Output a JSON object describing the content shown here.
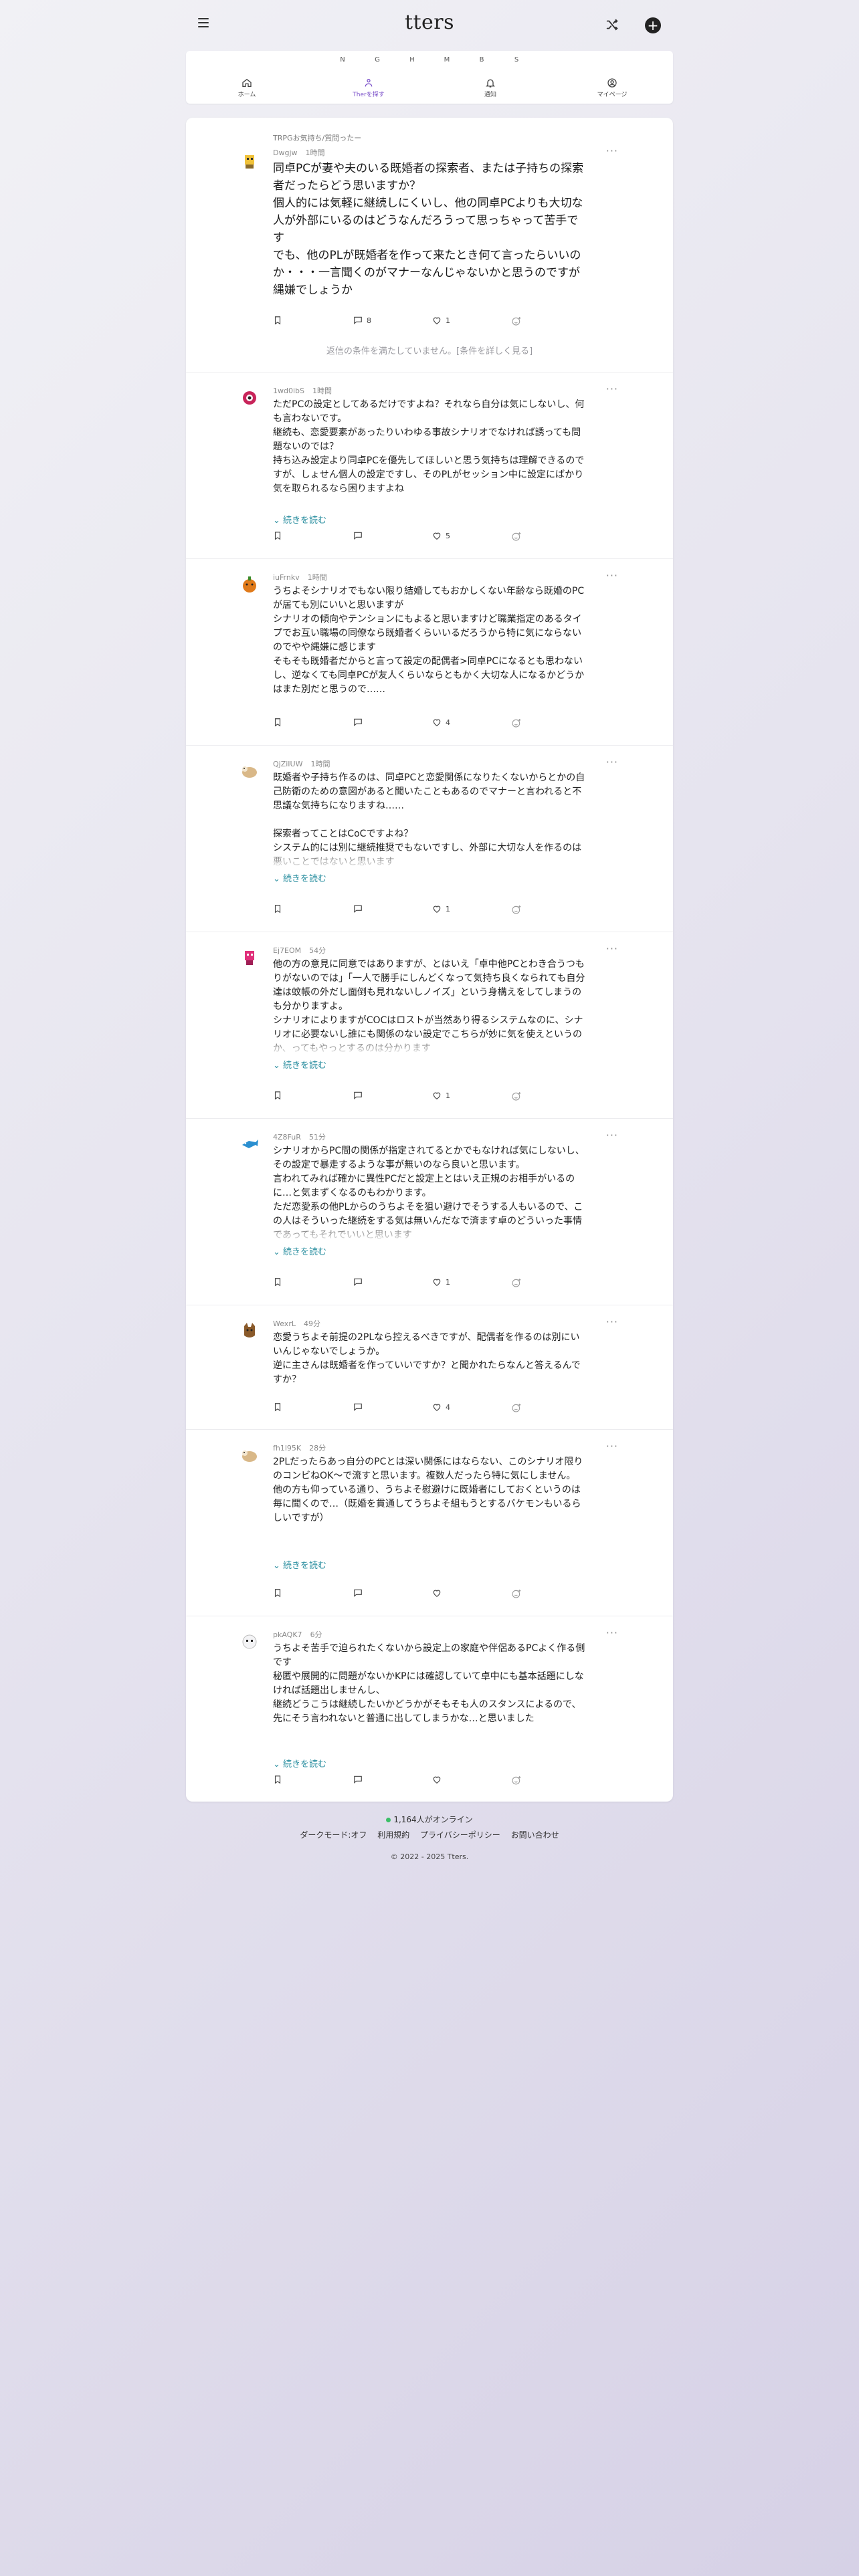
{
  "app": {
    "logo": "tters"
  },
  "letters": [
    "N",
    "G",
    "H",
    "M",
    "B",
    "S"
  ],
  "nav": [
    {
      "label": "ホーム",
      "icon": "home-icon"
    },
    {
      "label": "Therを探す",
      "icon": "people-icon",
      "active": true
    },
    {
      "label": "通知",
      "icon": "bell-icon"
    },
    {
      "label": "マイページ",
      "icon": "user-icon"
    }
  ],
  "feed": {
    "tag": "TRPGお気持ち/質問ったー",
    "hidden_note": "返信の条件を満たしていません。[条件を詳しく見る]",
    "read_more": "続きを読む",
    "posts": [
      {
        "user": "Dwgjw",
        "time": "1時間",
        "text": "同卓PCが妻や夫のいる既婚者の探索者、または子持ちの探索者だったらどう思いますか？\n個人的には気軽に継続しにくいし、他の同卓PCよりも大切な人が外部にいるのはどうなんだろうって思っちゃって苦手です\nでも、他のPLが既婚者を作って来たとき何て言ったらいいのか・・・一言聞くのがマナーなんじゃないかと思うのですが縄嫌でしょうか",
        "replies": "8",
        "likes": "1"
      },
      {
        "user": "1wd0ibS",
        "time": "1時間",
        "text": "ただPCの設定としてあるだけですよね？それなら自分は気にしないし、何も言わないです。\n継続も、恋愛要素があったりいわゆる事故シナリオでなければ誘っても問題ないのでは？\n持ち込み設定より同卓PCを優先してほしいと思う気持ちは理解できるのですが、しょせん個人の設定ですし、そのPLがセッション中に設定にばかり気を取られるなら困りますよね",
        "replies": "",
        "likes": "5"
      },
      {
        "user": "iuFrnkv",
        "time": "1時間",
        "text": "うちよそシナリオでもない限り結婚してもおかしくない年齢なら既婚のPCが居ても別にいいと思いますが\nシナリオの傾向やテンションにもよると思いますけど職業指定のあるタイプでお互い職場の同僚なら既婚者くらいいるだろうから特に気にならないのでやや縄嫌に感じます\nそもそも既婚者だからと言って設定の配偶者>同卓PCになるとも思わないし、逆なくても同卓PCが友人くらいならともかく大切な人になるかどうかはまた別だと思うので……",
        "replies": "",
        "likes": "4"
      },
      {
        "user": "QjZiIUW",
        "time": "1時間",
        "text": "既婚者や子持ち作るのは、同卓PCと恋愛関係になりたくないからとかの自己防衛のための意図があると聞いたこともあるのでマナーと言われると不思議な気持ちになりますね……\n\n探索者ってことはCoCですよね？\nシステム的には別に継続推奨でもないですし、外部に大切な人を作るのは悪いことではないと思います",
        "replies": "",
        "likes": "1"
      },
      {
        "user": "Ej7EOM",
        "time": "54分",
        "text": "他の方の意見に同意ではありますが、とはいえ「卓中他PCとわき合うつもりがないのでは」「一人で勝手にしんどくなって気持ち良くなられても自分達は蚊帳の外だし面倒も見れないしノイズ」という身構えをしてしまうのも分かりますよ。\nシナリオによりますがCOCはロストが当然あり得るシステムなのに、シナリオに必要ないし誰にも関係のない設定でこちらが妙に気を使えというのか、ってもやっとするのは分かります",
        "replies": "",
        "likes": "1"
      },
      {
        "user": "4Z8FuR",
        "time": "51分",
        "text": "シナリオからPC間の関係が指定されてるとかでもなければ気にしないし、その設定で暴走するような事が無いのなら良いと思います。\n言われてみれば確かに異性PCだと設定上とはいえ正規のお相手がいるのに…と気まずくなるのもわかります。\nただ恋愛系の他PLからのうちよそを狙い避けでそうする人もいるので、この人はそういった継続をする気は無いんだなで済ます卓のどういった事情であってもそれでいいと思います",
        "replies": "",
        "likes": "1"
      },
      {
        "user": "WexrL",
        "time": "49分",
        "text": "恋愛うちよそ前提の2PLなら控えるべきですが、配偶者を作るのは別にいいんじゃないでしょうか。\n逆に主さんは既婚者を作っていいですか？と聞かれたらなんと答えるんですか？",
        "replies": "",
        "likes": "4"
      },
      {
        "user": "fh1l95K",
        "time": "28分",
        "text": "2PLだったらあっ自分のPCとは深い関係にはならない、このシナリオ限りのコンビねOK〜で流すと思います。複数人だったら特に気にしません。\n他の方も仰っている通り、うちよそ慰避けに既婚者にしておくというのは毎に聞くので…（既婚を貫通してうちよそ組もうとするバケモンもいるらしいですが）",
        "replies": "",
        "likes": ""
      },
      {
        "user": "pkAQK7",
        "time": "6分",
        "text": "うちよそ苦手で迫られたくないから設定上の家庭や伴侶あるPCよく作る側です\n秘匿や展開的に問題がないかKPには確認していて卓中にも基本話題にしなければ話題出しませんし、\n継続どうこうは継続したいかどうかがそもそも人のスタンスによるので、先にそう言われないと普通に出してしまうかな…と思いました",
        "replies": "",
        "likes": ""
      }
    ]
  },
  "footer": {
    "online": "1,164人がオンライン",
    "links": [
      "ダークモード:オフ",
      "利用規約",
      "プライバシーポリシー",
      "お問い合わせ"
    ],
    "copyright": "© 2022 - 2025 Tters."
  }
}
